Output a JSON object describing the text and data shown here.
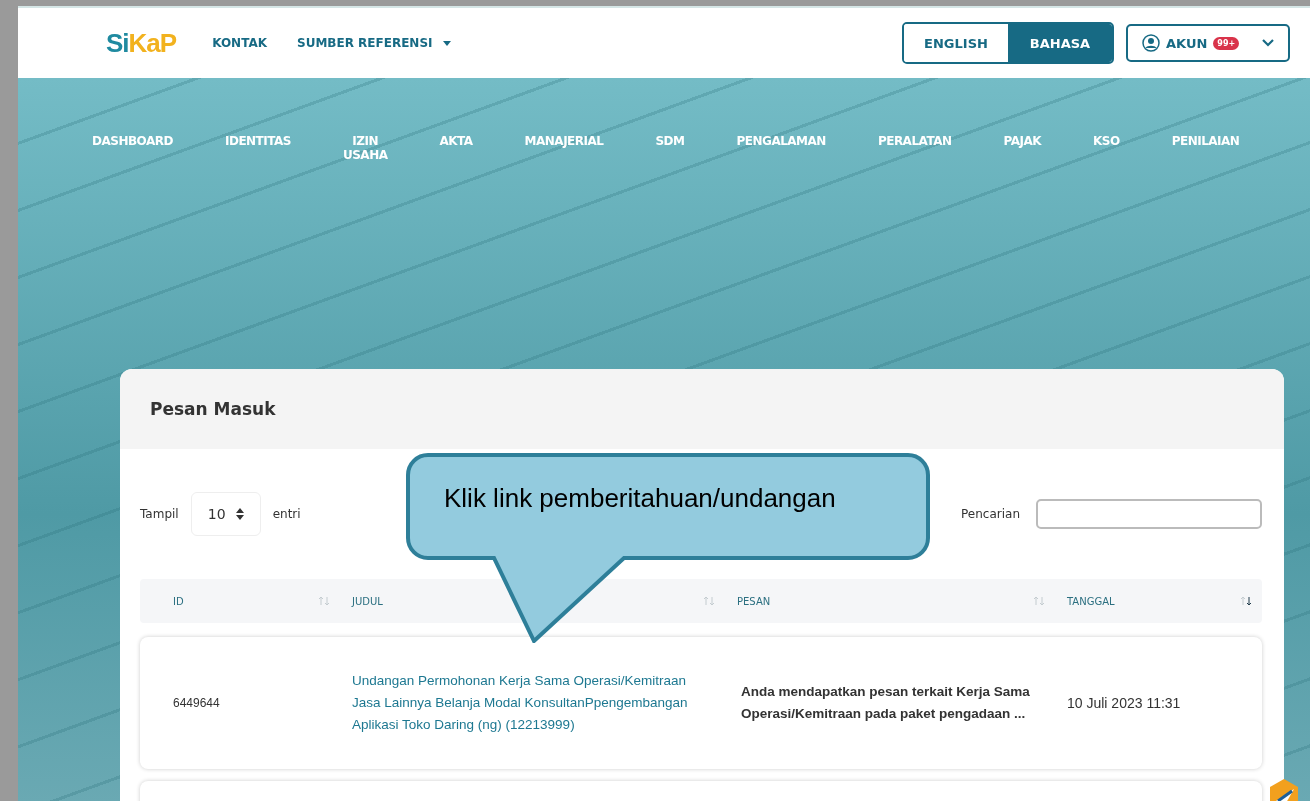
{
  "header": {
    "logo": {
      "part_1": "Si",
      "part_2": "KaP"
    },
    "links": [
      {
        "label": "KONTAK",
        "dropdown": false
      },
      {
        "label": "SUMBER REFERENSI",
        "dropdown": true
      }
    ],
    "languages": [
      {
        "label": "ENGLISH",
        "selected": false
      },
      {
        "label": "BAHASA",
        "selected": true
      }
    ],
    "account": {
      "label": "AKUN",
      "badge": "99+"
    }
  },
  "nav": [
    "DASHBOARD",
    "IDENTITAS",
    "IZIN USAHA",
    "AKTA",
    "MANAJERIAL",
    "SDM",
    "PENGALAMAN",
    "PERALATAN",
    "PAJAK",
    "KSO",
    "PENILAIAN"
  ],
  "panel": {
    "title": "Pesan Masuk",
    "show_label": "Tampil",
    "page_size": "10",
    "entries_label": "entri",
    "search_label": "Pencarian",
    "table": {
      "columns": [
        {
          "label": "ID",
          "sorted_desc": false
        },
        {
          "label": "JUDUL",
          "sorted_desc": false
        },
        {
          "label": "PESAN",
          "sorted_desc": false
        },
        {
          "label": "TANGGAL",
          "sorted_desc": true
        }
      ],
      "rows": [
        {
          "id": "6449644",
          "title": "Undangan Permohonan Kerja Sama Operasi/Kemitraan Jasa Lainnya Belanja Modal KonsultanPpengembangan Aplikasi Toko Daring (ng) (12213999)",
          "message": "Anda mendapatkan pesan terkait Kerja Sama Operasi/Kemitraan pada paket pengadaan ...",
          "date": "10 Juli 2023 11:31"
        }
      ]
    }
  },
  "callout": {
    "text": "Klik link pemberitahuan/undangan"
  }
}
